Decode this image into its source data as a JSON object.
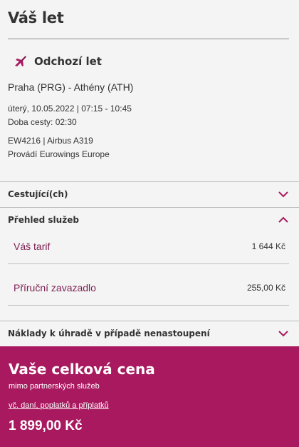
{
  "header": {
    "title": "Váš let"
  },
  "flight": {
    "heading": "Odchozí let",
    "route": "Praha (PRG) - Athény (ATH)",
    "datetime": "úterý, 10.05.2022 | 07:15 - 10:45",
    "duration": "Doba cesty: 02:30",
    "flight_info": "EW4216 | Airbus A319",
    "operator": "Provádí Eurowings Europe"
  },
  "sections": {
    "passengers": {
      "label": "Cestující(ch)",
      "expanded": false
    },
    "services": {
      "label": "Přehled služeb",
      "expanded": true,
      "items": [
        {
          "label": "Váš tarif",
          "price": "1 644 Kč"
        },
        {
          "label": "Příruční zavazadlo",
          "price": "255,00 Kč"
        }
      ]
    },
    "no_show": {
      "label": "Náklady k úhradě v případě nenastoupení",
      "expanded": false
    }
  },
  "total": {
    "title": "Vaše celková cena",
    "subtitle": "mimo partnerských služeb",
    "link": "vč. daní, poplatků a příplatků",
    "price": "1 899,00 Kč"
  },
  "colors": {
    "accent": "#a8195f",
    "accent_text": "#7d1f52",
    "background": "#f4f4f4"
  },
  "icons": {
    "flight": "airplane-takeoff-icon",
    "collapsed": "chevron-down-icon",
    "expanded": "chevron-up-icon"
  }
}
